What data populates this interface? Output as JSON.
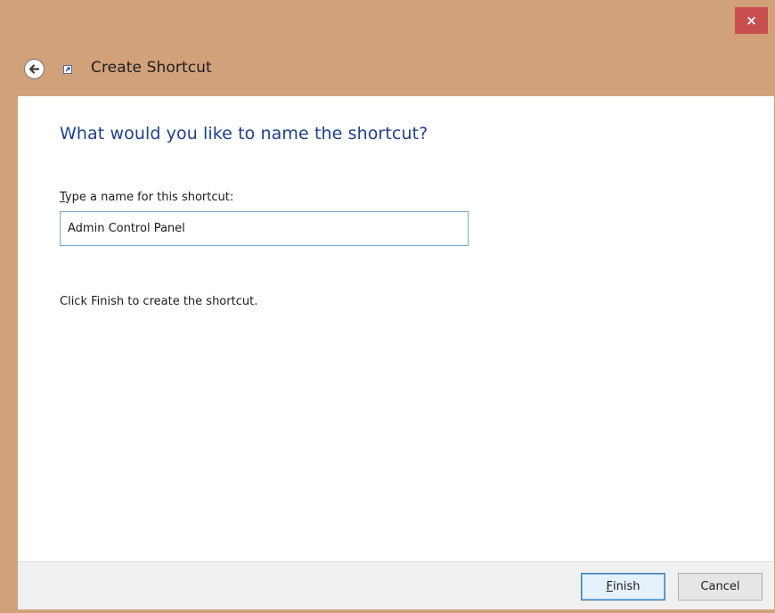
{
  "window": {
    "close_label": "×",
    "colors": {
      "frame": "#d1a27a",
      "close": "#c7504f",
      "heading": "#1e3f8d",
      "input_border": "#7aa7cf",
      "footer": "#f0f0f0"
    }
  },
  "header": {
    "back_icon": "back-arrow-icon",
    "shortcut_icon": "shortcut-icon",
    "title": "Create Shortcut"
  },
  "main": {
    "question": "What would you like to name the shortcut?",
    "field_label_first": "T",
    "field_label_rest": "ype a name for this shortcut:",
    "name_value": "Admin Control Panel",
    "hint": "Click Finish to create the shortcut."
  },
  "footer": {
    "finish_first": "F",
    "finish_rest": "inish",
    "cancel_label": "Cancel"
  }
}
